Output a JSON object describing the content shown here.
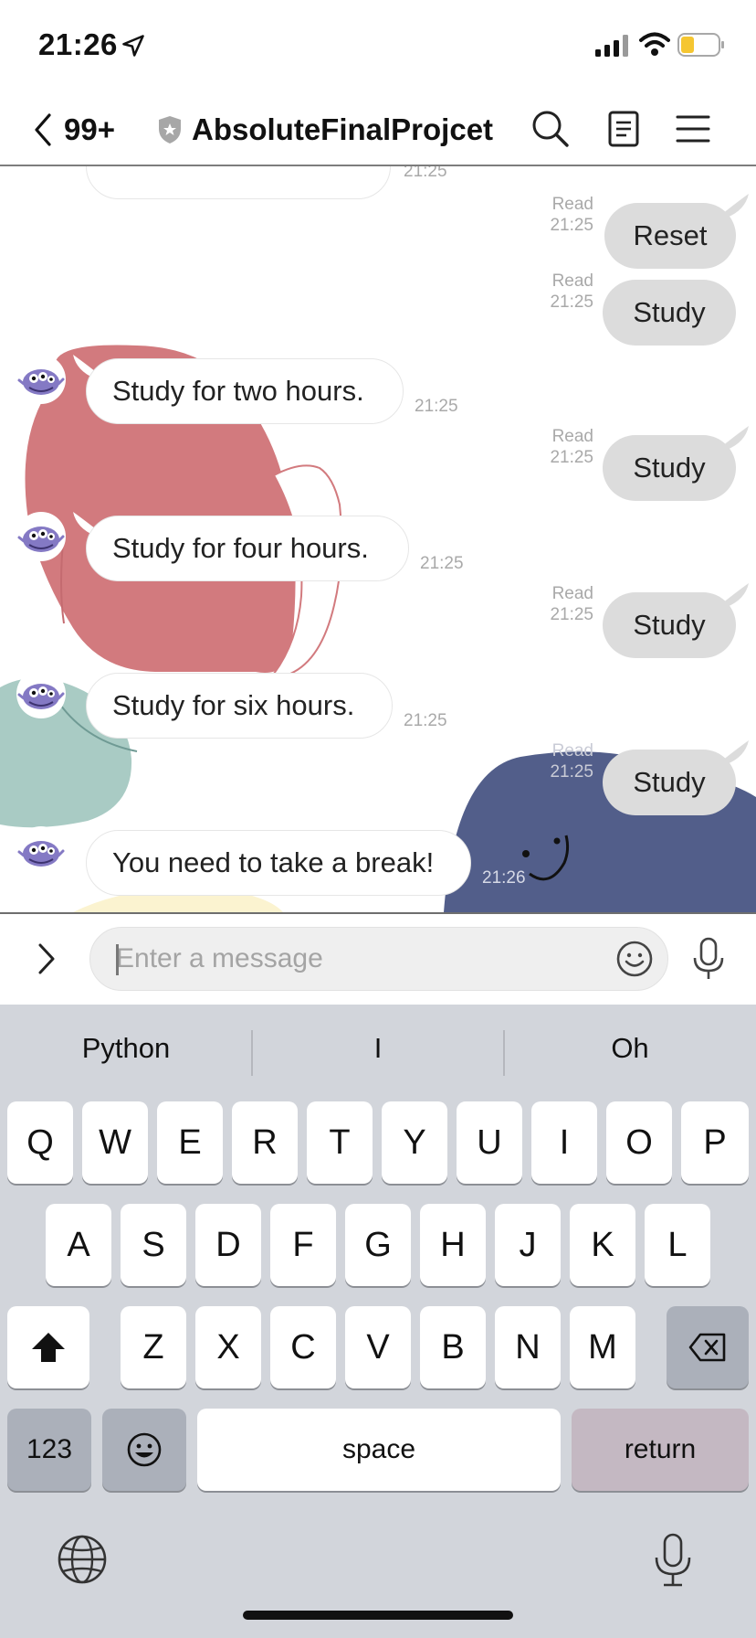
{
  "status_bar": {
    "time": "21:26",
    "icons": [
      "location-arrow-icon",
      "cellular-signal-icon",
      "wifi-icon",
      "battery-icon"
    ],
    "battery_level_fraction": 0.3
  },
  "header": {
    "back_count": "99+",
    "title": "AbsoluteFinalProjcet",
    "icons": [
      "search-icon",
      "notes-icon",
      "menu-icon"
    ]
  },
  "chat": {
    "partial_top_time": "21:25",
    "messages": [
      {
        "direction": "out",
        "text": "Reset",
        "read": "Read",
        "time": "21:25"
      },
      {
        "direction": "out",
        "text": "Study",
        "read": "Read",
        "time": "21:25"
      },
      {
        "direction": "in",
        "text": "Study for two hours.",
        "time": "21:25"
      },
      {
        "direction": "out",
        "text": "Study",
        "read": "Read",
        "time": "21:25"
      },
      {
        "direction": "in",
        "text": "Study for four hours.",
        "time": "21:25"
      },
      {
        "direction": "out",
        "text": "Study",
        "read": "Read",
        "time": "21:25"
      },
      {
        "direction": "in",
        "text": "Study for six hours.",
        "time": "21:25"
      },
      {
        "direction": "out",
        "text": "Study",
        "read": "Read",
        "time": "21:25"
      },
      {
        "direction": "in",
        "text": "You need to take a break!",
        "time": "21:26"
      }
    ]
  },
  "input": {
    "placeholder": "Enter a message"
  },
  "keyboard": {
    "suggestions": [
      "Python",
      "I",
      "Oh"
    ],
    "row1": [
      "Q",
      "W",
      "E",
      "R",
      "T",
      "Y",
      "U",
      "I",
      "O",
      "P"
    ],
    "row2": [
      "A",
      "S",
      "D",
      "F",
      "G",
      "H",
      "J",
      "K",
      "L"
    ],
    "row3": [
      "Z",
      "X",
      "C",
      "V",
      "B",
      "N",
      "M"
    ],
    "numbers_label": "123",
    "space_label": "space",
    "return_label": "return"
  },
  "colors": {
    "outgoing_bubble": "#dcdcdc",
    "incoming_bubble": "#ffffff",
    "keyboard_bg": "#d2d5db",
    "art_pink": "#d27a7e",
    "art_teal": "#a9cbc4",
    "art_navy": "#525e8a",
    "art_yellow": "#fbf3d0"
  }
}
